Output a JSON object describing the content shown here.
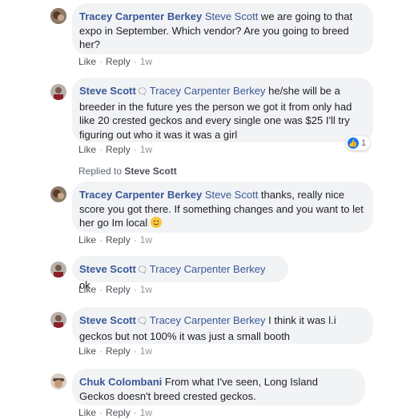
{
  "comments": [
    {
      "author": "Tracey Carpenter Berkey",
      "mention": "Steve Scott",
      "text": " we are going to that expo in September. Which vendor? Are you going to breed her?",
      "like": "Like",
      "reply": "Reply",
      "time": "1w"
    },
    {
      "author": "Steve Scott",
      "mention": "Tracey Carpenter Berkey",
      "text": " he/she will be a breeder in the future yes the person we got it from only had like 20 crested geckos and every single one was $25 I'll try figuring out who it was it was a girl",
      "like": "Like",
      "reply": "Reply",
      "time": "1w",
      "reactions": "1"
    },
    {
      "author": "Tracey Carpenter Berkey",
      "mention": "Steve Scott",
      "text": " thanks, really nice score you got there. If something changes and you want to let her go Im local ",
      "like": "Like",
      "reply": "Reply",
      "time": "1w"
    },
    {
      "author": "Steve Scott",
      "mention": "Tracey Carpenter Berkey",
      "text": " ok",
      "like": "Like",
      "reply": "Reply",
      "time": "1w"
    },
    {
      "author": "Steve Scott",
      "mention": "Tracey Carpenter Berkey",
      "text": " I think it was l.i geckos but not 100% it was just a small booth",
      "like": "Like",
      "reply": "Reply",
      "time": "1w"
    },
    {
      "author": "Chuk Colombani",
      "mention": "",
      "text": " From what I've seen, Long Island Geckos doesn't breed crested geckos.",
      "like": "Like",
      "reply": "Reply",
      "time": "1w"
    }
  ],
  "replied_to": {
    "prefix": "Replied to",
    "name": "Steve Scott"
  },
  "icons": {
    "messenger": "messenger-icon",
    "like": "like-reaction-icon",
    "smile": "smile-emoji-icon"
  }
}
